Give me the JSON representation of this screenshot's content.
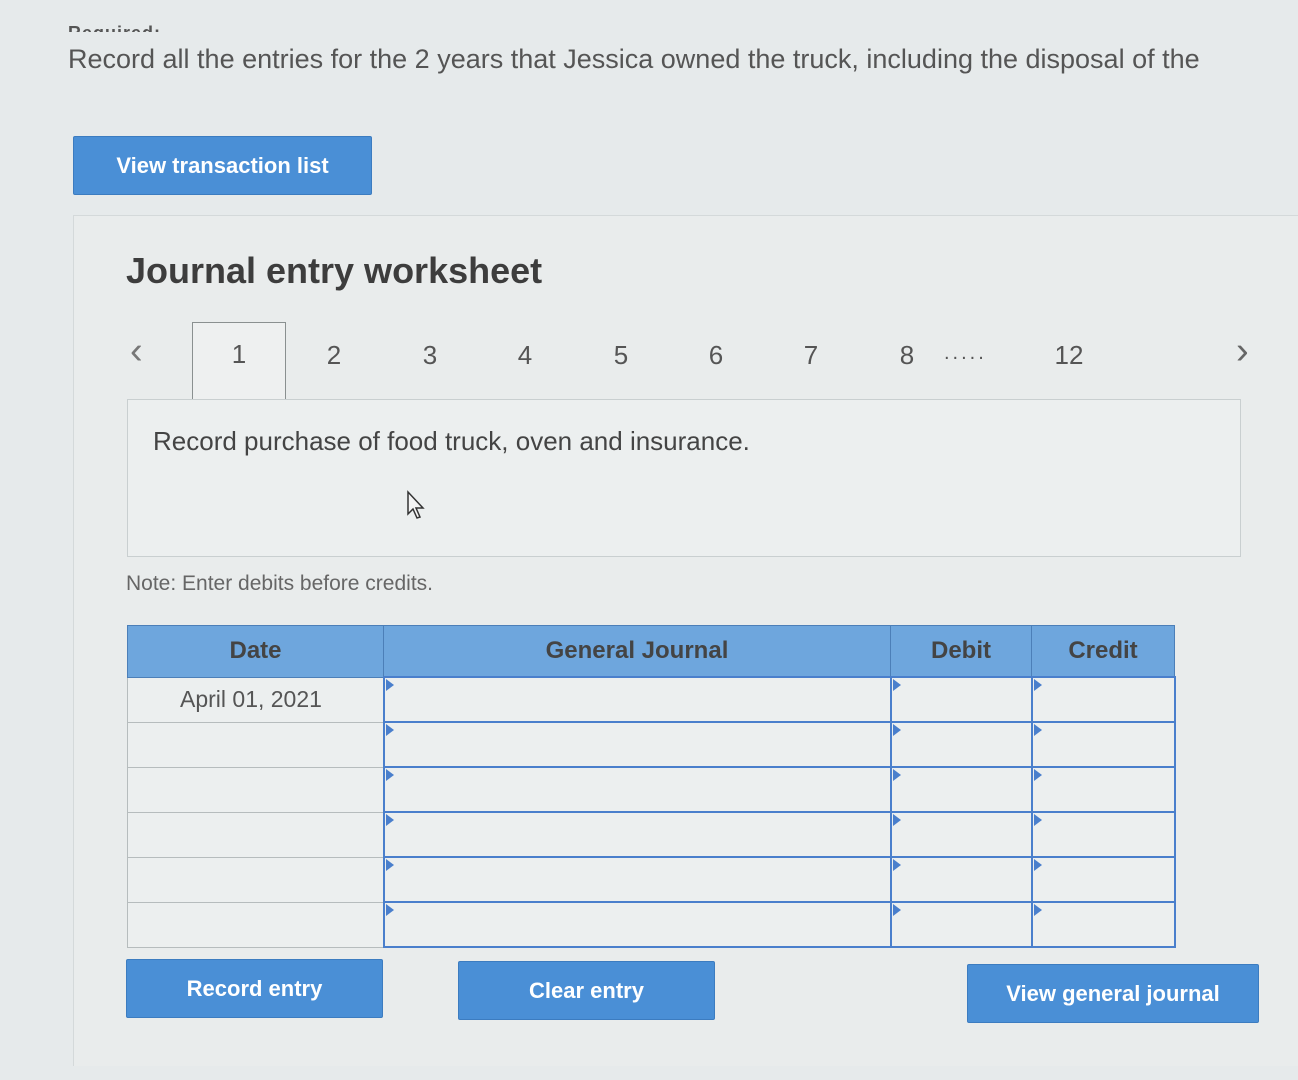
{
  "header": {
    "required_label": "Required:",
    "instruction": "Record all the entries for the 2 years that Jessica owned the truck, including the disposal of the"
  },
  "view_transaction_label": "View transaction list",
  "worksheet": {
    "title": "Journal entry worksheet",
    "tabs": [
      "1",
      "2",
      "3",
      "4",
      "5",
      "6",
      "7",
      "8",
      "12"
    ],
    "active_tab": "1",
    "tab_ellipsis": ".....",
    "description": "Record purchase of food truck, oven and insurance.",
    "note": "Note: Enter debits before credits."
  },
  "table": {
    "headers": {
      "date": "Date",
      "journal": "General Journal",
      "debit": "Debit",
      "credit": "Credit"
    },
    "rows": [
      {
        "date": "April 01, 2021",
        "account": "",
        "debit": "",
        "credit": ""
      },
      {
        "date": "",
        "account": "",
        "debit": "",
        "credit": ""
      },
      {
        "date": "",
        "account": "",
        "debit": "",
        "credit": ""
      },
      {
        "date": "",
        "account": "",
        "debit": "",
        "credit": ""
      },
      {
        "date": "",
        "account": "",
        "debit": "",
        "credit": ""
      },
      {
        "date": "",
        "account": "",
        "debit": "",
        "credit": ""
      }
    ]
  },
  "buttons": {
    "record_entry": "Record entry",
    "clear_entry": "Clear entry",
    "view_general_journal": "View general journal"
  },
  "icons": {
    "prev": "chevron-left-icon",
    "next": "chevron-right-icon",
    "cursor": "mouse-pointer-icon"
  },
  "colors": {
    "accent": "#4a8fd6",
    "header_bg": "#6ea6dd",
    "input_border": "#4a7fcc"
  }
}
